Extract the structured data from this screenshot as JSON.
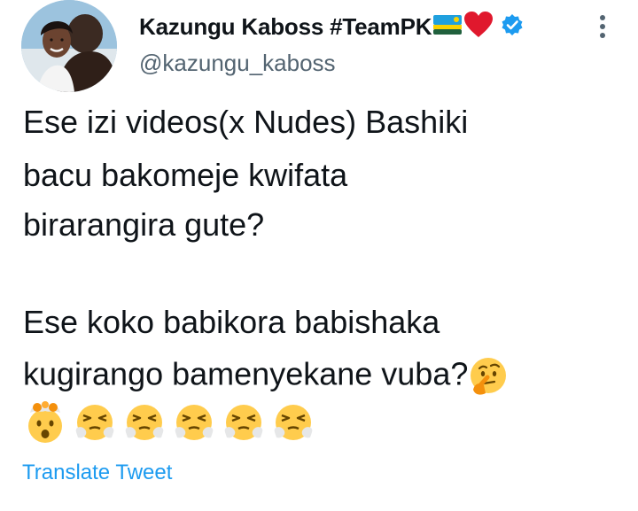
{
  "author": {
    "display_name": "Kazungu Kaboss #TeamPK",
    "handle": "@kazungu_kaboss",
    "verified": true
  },
  "body": {
    "lines": [
      "Ese izi videos(x Nudes) Bashiki",
      "bacu bakomeje kwifata",
      "birarangira gute?",
      "Ese koko babikora babishaka",
      "kugirango bamenyekane vuba?"
    ],
    "emojis_inline": [
      "thinking-face"
    ],
    "emojis_row": [
      "exploding-head",
      "face-with-steam",
      "face-with-steam",
      "face-with-steam",
      "face-with-steam",
      "face-with-steam"
    ]
  },
  "actions": {
    "translate_label": "Translate Tweet"
  },
  "colors": {
    "accent": "#1d9bf0",
    "text": "#0f1419",
    "muted": "#536471"
  }
}
